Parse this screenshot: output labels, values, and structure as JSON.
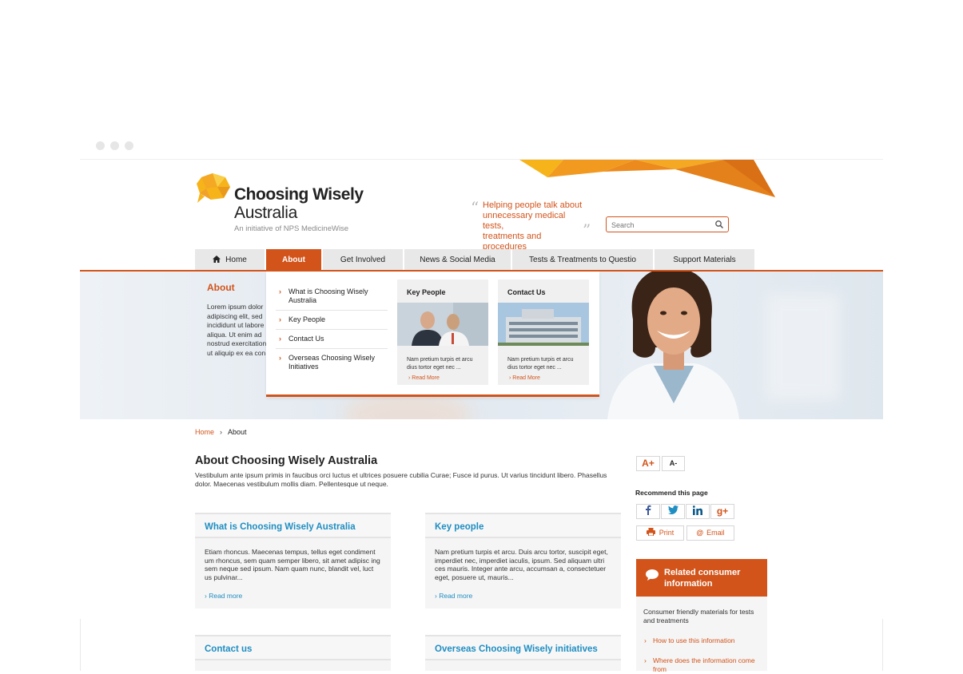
{
  "brand": {
    "title_line1": "Choosing Wisely",
    "title_line2": "Australia",
    "initiative": "An initiative of NPS MedicineWise",
    "tagline_line1": "Helping people talk about",
    "tagline_line2": "unnecessary medical tests,",
    "tagline_line3": "treatments and procedures",
    "accent_color": "#d2541b",
    "link_color": "#1f8ec2"
  },
  "search": {
    "placeholder": "Search",
    "icon": "search-icon"
  },
  "nav": {
    "items": [
      {
        "label": "Home",
        "icon": "home-icon"
      },
      {
        "label": "About",
        "active": true
      },
      {
        "label": "Get Involved"
      },
      {
        "label": "News & Social Media"
      },
      {
        "label": "Tests & Treatments to Questio"
      },
      {
        "label": "Support Materials"
      }
    ]
  },
  "hero": {
    "title": "About",
    "text_lines": [
      "Lorem ipsum dolor",
      "adipiscing elit, sed",
      "incididunt ut labore",
      "aliqua. Ut enim ad",
      "nostrud exercitation",
      "ut aliquip ex ea con"
    ]
  },
  "dropdown": {
    "links": [
      "What is Choosing Wisely Australia",
      "Key People",
      "Contact Us",
      "Overseas Choosing Wisely Initiatives"
    ],
    "cards": [
      {
        "title": "Key People",
        "text": "Nam pretium turpis et arcu dius tortor eget nec ...",
        "more": "Read More"
      },
      {
        "title": "Contact Us",
        "text": "Nam pretium turpis et arcu dius tortor eget nec ...",
        "more": "Read More"
      }
    ]
  },
  "breadcrumb": {
    "home": "Home",
    "separator": "›",
    "current": "About"
  },
  "main": {
    "title": "About Choosing Wisely Australia",
    "intro": "Vestibulum ante ipsum primis in faucibus orci luctus et ultrices posuere cubilia Curae; Fusce id purus. Ut varius tincidunt libero. Phasellus dolor. Maecenas vestibulum mollis diam. Pellentesque ut neque.",
    "panels": [
      {
        "title": "What is Choosing Wisely Australia",
        "body": "Etiam rhoncus. Maecenas tempus, tellus eget condiment um rhoncus, sem quam semper libero, sit amet adipisc ing sem neque sed ipsum. Nam quam nunc, blandit vel, luct us pulvinar...",
        "more": "Read more"
      },
      {
        "title": "Key people",
        "body": "Nam pretium turpis et arcu. Duis arcu tortor, suscipit eget, imperdiet nec, imperdiet iaculis, ipsum. Sed aliquam ultri ces mauris. Integer ante arcu, accumsan a, consectetuer eget, posuere ut, mauris...",
        "more": "Read more"
      },
      {
        "title": "Contact us"
      },
      {
        "title": "Overseas Choosing Wisely initiatives"
      }
    ]
  },
  "sidebar": {
    "font_increase": "A+",
    "font_decrease": "A-",
    "recommend_label": "Recommend this page",
    "social": [
      "facebook-icon",
      "twitter-icon",
      "linkedin-icon",
      "googleplus-icon"
    ],
    "print_label": "Print",
    "email_label": "Email",
    "related_title": "Related consumer information",
    "related_text": "Consumer friendly materials for tests and treatments",
    "related_links": [
      "How to use this information",
      "Where does the information come from"
    ]
  }
}
